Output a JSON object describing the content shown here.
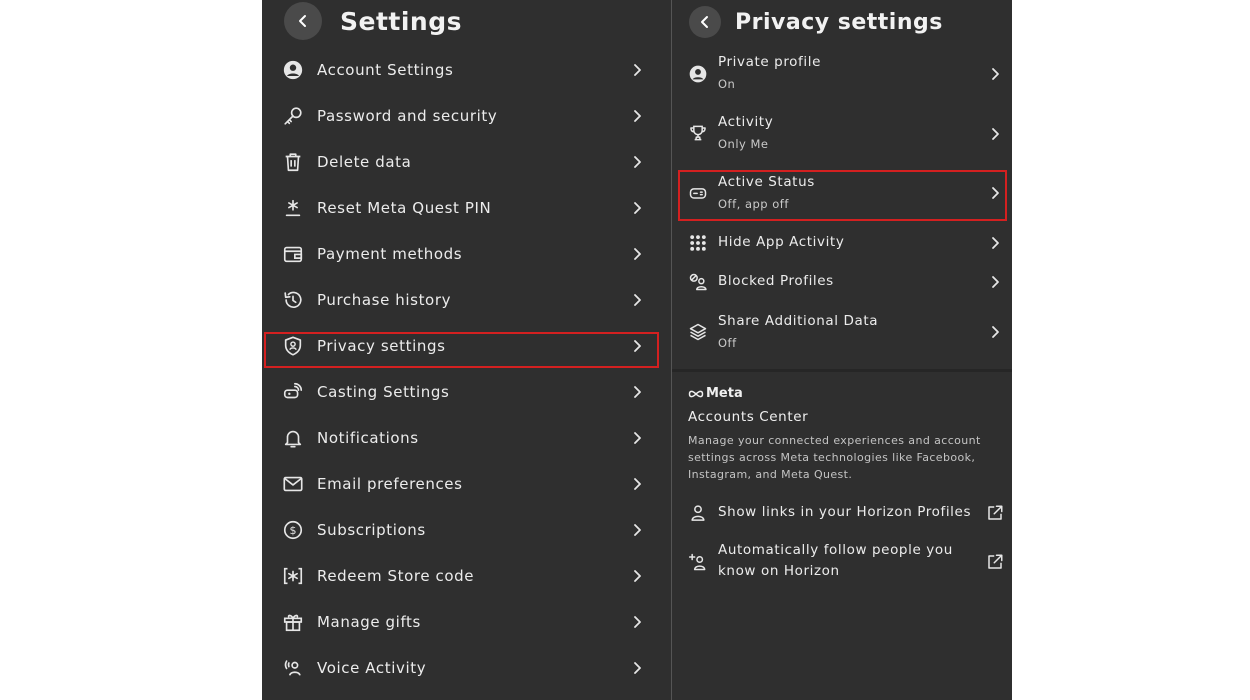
{
  "settings_panel": {
    "title": "Settings",
    "items": [
      {
        "label": "Account Settings",
        "icon": "account-circle-icon"
      },
      {
        "label": "Password and security",
        "icon": "key-icon"
      },
      {
        "label": "Delete data",
        "icon": "trash-icon"
      },
      {
        "label": "Reset Meta Quest PIN",
        "icon": "asterisk-icon"
      },
      {
        "label": "Payment methods",
        "icon": "wallet-icon"
      },
      {
        "label": "Purchase history",
        "icon": "history-icon"
      },
      {
        "label": "Privacy settings",
        "icon": "shield-user-icon"
      },
      {
        "label": "Casting Settings",
        "icon": "casting-icon"
      },
      {
        "label": "Notifications",
        "icon": "bell-icon"
      },
      {
        "label": "Email preferences",
        "icon": "mail-icon"
      },
      {
        "label": "Subscriptions",
        "icon": "dollar-circle-icon"
      },
      {
        "label": "Redeem Store code",
        "icon": "bracket-asterisk-icon"
      },
      {
        "label": "Manage gifts",
        "icon": "gift-icon"
      },
      {
        "label": "Voice Activity",
        "icon": "voice-icon"
      }
    ]
  },
  "privacy_panel": {
    "title": "Privacy settings",
    "items": [
      {
        "label": "Private profile",
        "value": "On",
        "icon": "account-circle-icon"
      },
      {
        "label": "Activity",
        "value": "Only Me",
        "icon": "trophy-icon"
      },
      {
        "label": "Active Status",
        "value": "Off, app off",
        "icon": "gamepad-icon"
      },
      {
        "label": "Hide App Activity",
        "icon": "apps-grid-icon"
      },
      {
        "label": "Blocked Profiles",
        "icon": "blocked-profiles-icon"
      },
      {
        "label": "Share Additional Data",
        "value": "Off",
        "icon": "layers-icon"
      }
    ],
    "accounts_center": {
      "brand": "Meta",
      "title": "Accounts Center",
      "description": "Manage your connected experiences and account settings across Meta technologies like Facebook, Instagram, and Meta Quest.",
      "links": [
        {
          "label": "Show links in your Horizon Profiles",
          "icon": "person-icon"
        },
        {
          "label": "Automatically follow people you know on Horizon",
          "icon": "person-add-icon"
        }
      ]
    }
  },
  "colors": {
    "panel_bg": "#2f2f2f",
    "highlight": "#d42020",
    "text": "#ececec"
  }
}
